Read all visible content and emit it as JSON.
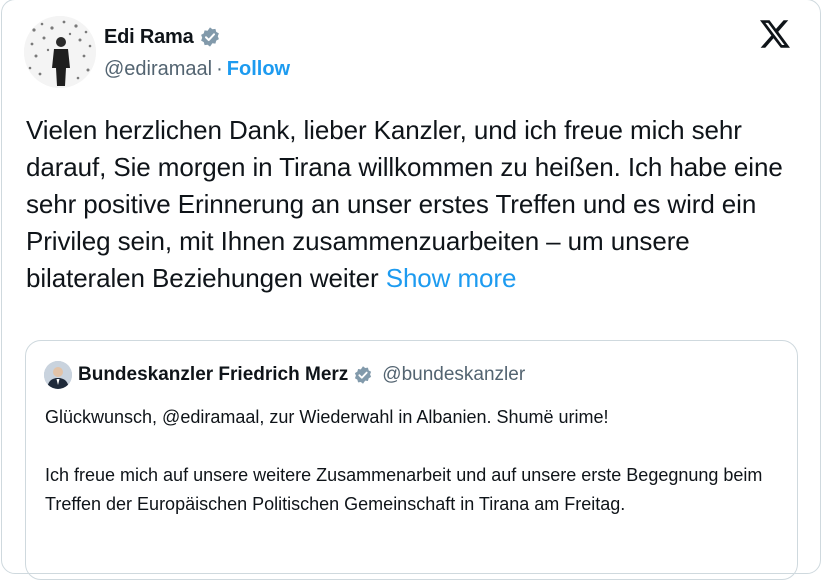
{
  "author": {
    "name": "Edi Rama",
    "handle": "@ediramaal",
    "separator": "·",
    "follow_label": "Follow"
  },
  "tweet": {
    "text": "Vielen herzlichen Dank, lieber Kanzler, und ich freue mich sehr darauf, Sie morgen in Tirana willkommen zu heißen. Ich habe eine sehr positive Erinnerung an unser erstes Treffen und es wird ein Privileg sein, mit Ihnen zusammenzuarbeiten – um unsere bilateralen Beziehungen weiter",
    "show_more": "Show more"
  },
  "quoted": {
    "name": "Bundeskanzler Friedrich Merz",
    "handle": "@bundeskanzler",
    "paragraph1": "Glückwunsch, @ediramaal, zur Wiederwahl in Albanien. Shumë urime!",
    "paragraph2": "Ich freue mich auf unsere weitere Zusammenarbeit und auf unsere erste Begegnung beim Treffen der Europäischen Politischen Gemeinschaft in Tirana am Freitag."
  },
  "colors": {
    "link": "#1d9bf0",
    "secondary_text": "#536471",
    "border": "#cfd9de",
    "verified_badge": "#829aab"
  },
  "icons": {
    "verified": "verified-badge-icon",
    "platform": "x-logo-icon"
  }
}
